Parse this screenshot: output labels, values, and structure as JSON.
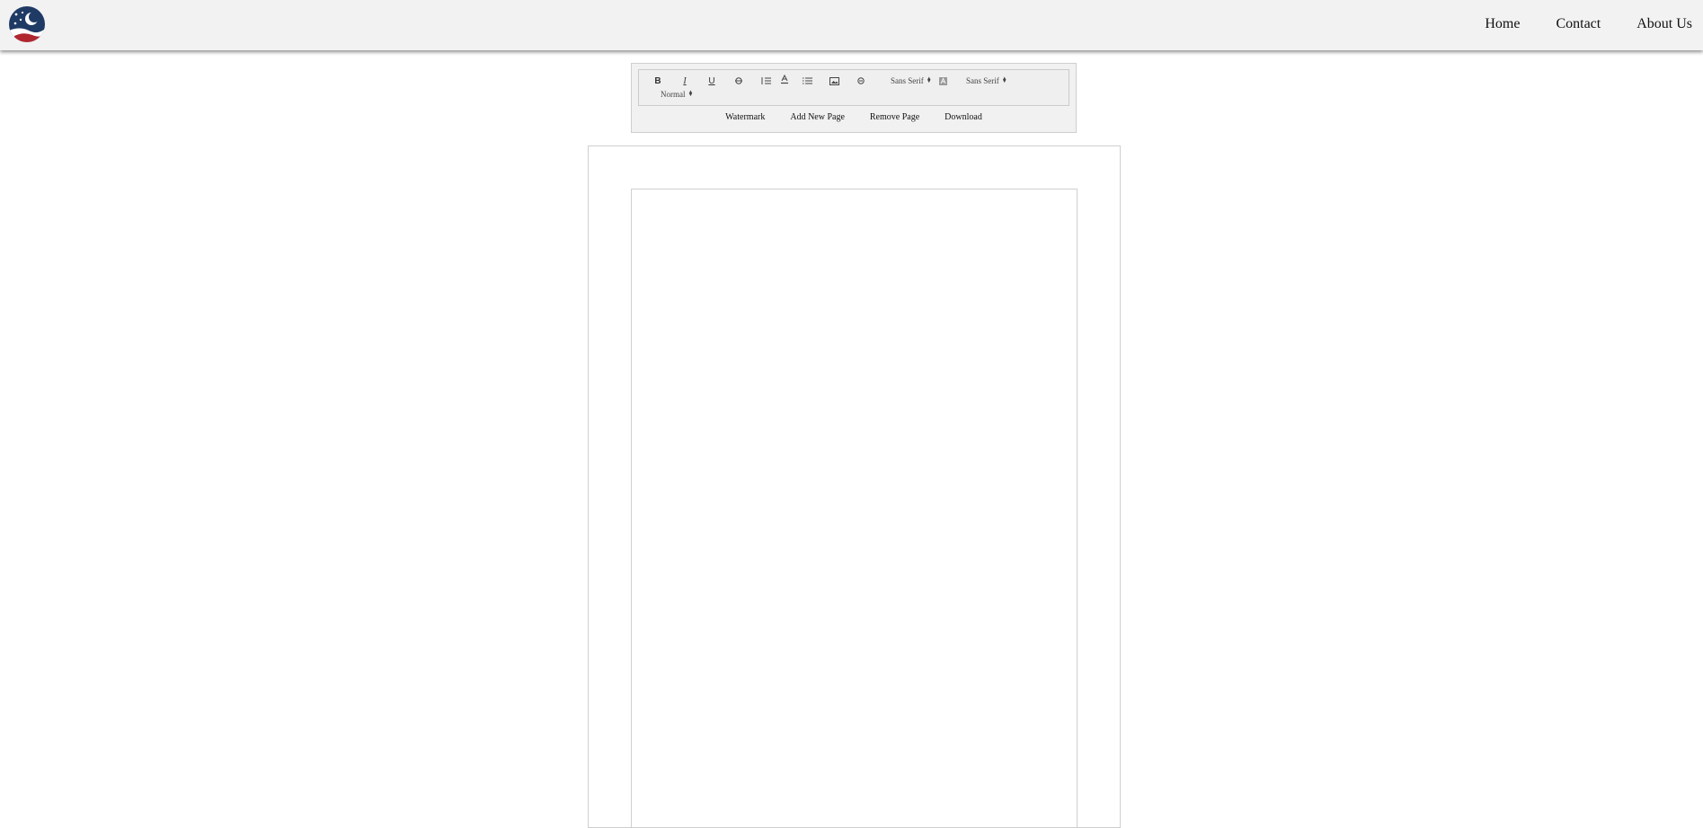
{
  "nav": {
    "logo_icon": "moon-stars-flag-logo",
    "links": [
      "Home",
      "Contact",
      "About Us"
    ]
  },
  "toolbar": {
    "icons": [
      "bold-icon",
      "italic-icon",
      "underline-icon",
      "strikethrough-icon",
      "ordered-list-icon",
      "text-color-icon",
      "bullet-list-icon",
      "image-icon",
      "link-icon",
      "background-color-icon"
    ],
    "bold_label": "B",
    "italic_label": "I",
    "underline_label": "U",
    "font_select_1": "Sans Serif",
    "font_select_2": "Sans Serif",
    "size_select": "Normal"
  },
  "actions": [
    "Watermark",
    "Add New Page",
    "Remove Page",
    "Download"
  ],
  "colors": {
    "navbar_bg": "#f2f2f2",
    "logo_navy": "#1f3a64",
    "logo_red": "#b0272f"
  }
}
